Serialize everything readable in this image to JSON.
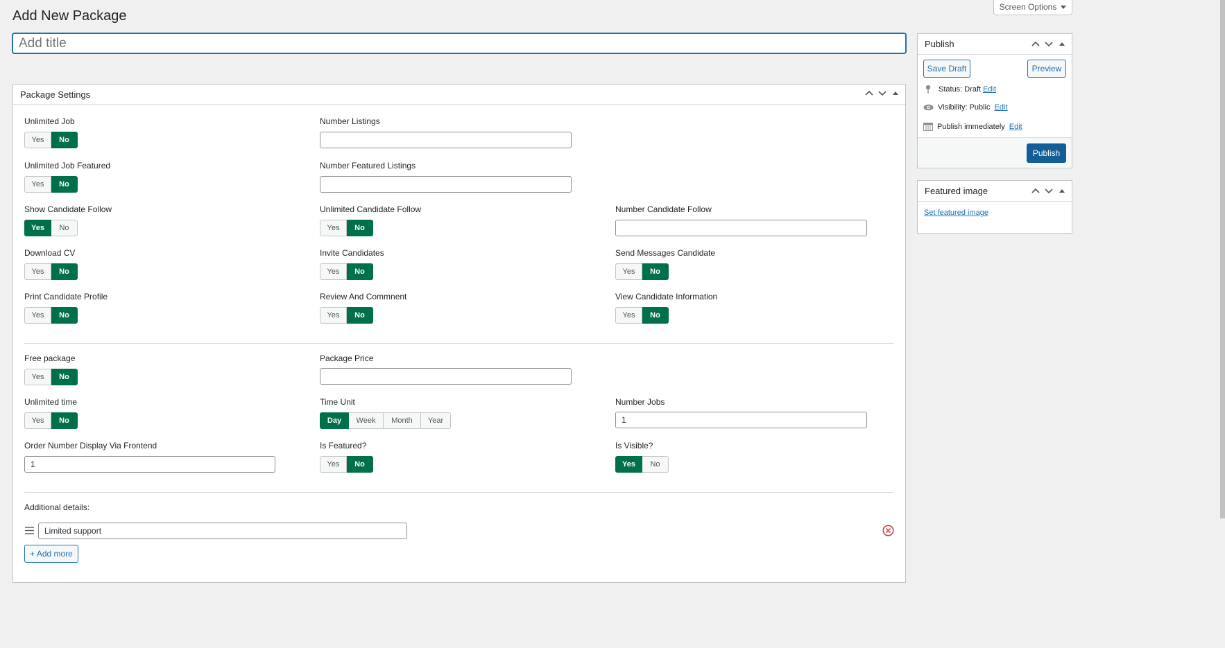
{
  "header": {
    "page_title": "Add New Package",
    "screen_options": "Screen Options",
    "title_placeholder": "Add title"
  },
  "package_settings": {
    "title": "Package Settings",
    "fields": {
      "unlimited_job": {
        "label": "Unlimited Job",
        "yes": "Yes",
        "no": "No",
        "value": "No"
      },
      "number_listings": {
        "label": "Number Listings",
        "value": ""
      },
      "unlimited_job_featured": {
        "label": "Unlimited Job Featured",
        "yes": "Yes",
        "no": "No",
        "value": "No"
      },
      "number_featured_listings": {
        "label": "Number Featured Listings",
        "value": ""
      },
      "show_candidate_follow": {
        "label": "Show Candidate Follow",
        "yes": "Yes",
        "no": "No",
        "value": "Yes"
      },
      "unlimited_candidate_follow": {
        "label": "Unlimited Candidate Follow",
        "yes": "Yes",
        "no": "No",
        "value": "No"
      },
      "number_candidate_follow": {
        "label": "Number Candidate Follow",
        "value": ""
      },
      "download_cv": {
        "label": "Download CV",
        "yes": "Yes",
        "no": "No",
        "value": "No"
      },
      "invite_candidates": {
        "label": "Invite Candidates",
        "yes": "Yes",
        "no": "No",
        "value": "No"
      },
      "send_messages_candidate": {
        "label": "Send Messages Candidate",
        "yes": "Yes",
        "no": "No",
        "value": "No"
      },
      "print_candidate_profile": {
        "label": "Print Candidate Profile",
        "yes": "Yes",
        "no": "No",
        "value": "No"
      },
      "review_and_comment": {
        "label": "Review And Commnent",
        "yes": "Yes",
        "no": "No",
        "value": "No"
      },
      "view_candidate_information": {
        "label": "View Candidate Information",
        "yes": "Yes",
        "no": "No",
        "value": "No"
      },
      "free_package": {
        "label": "Free package",
        "yes": "Yes",
        "no": "No",
        "value": "No"
      },
      "package_price": {
        "label": "Package Price",
        "value": ""
      },
      "unlimited_time": {
        "label": "Unlimited time",
        "yes": "Yes",
        "no": "No",
        "value": "No"
      },
      "time_unit": {
        "label": "Time Unit",
        "options": [
          "Day",
          "Week",
          "Month",
          "Year"
        ],
        "value": "Day"
      },
      "number_jobs": {
        "label": "Number Jobs",
        "value": "1"
      },
      "order_number": {
        "label": "Order Number Display Via Frontend",
        "value": "1"
      },
      "is_featured": {
        "label": "Is Featured?",
        "yes": "Yes",
        "no": "No",
        "value": "No"
      },
      "is_visible": {
        "label": "Is Visible?",
        "yes": "Yes",
        "no": "No",
        "value": "Yes"
      }
    },
    "additional_details": {
      "label": "Additional details:",
      "items": [
        "Limited support"
      ],
      "add_more": "+ Add more"
    }
  },
  "publish": {
    "title": "Publish",
    "save_draft": "Save Draft",
    "preview": "Preview",
    "status_label": "Status:",
    "status_value": "Draft",
    "visibility_label": "Visibility:",
    "visibility_value": "Public",
    "publish_label": "Publish",
    "publish_value": "immediately",
    "edit": "Edit",
    "publish_button": "Publish"
  },
  "featured_image": {
    "title": "Featured image",
    "set_link": "Set featured image"
  },
  "colors": {
    "accent_green": "#00704a",
    "wp_blue": "#2271b1",
    "publish_blue": "#135e96",
    "remove_red": "#d63638"
  }
}
